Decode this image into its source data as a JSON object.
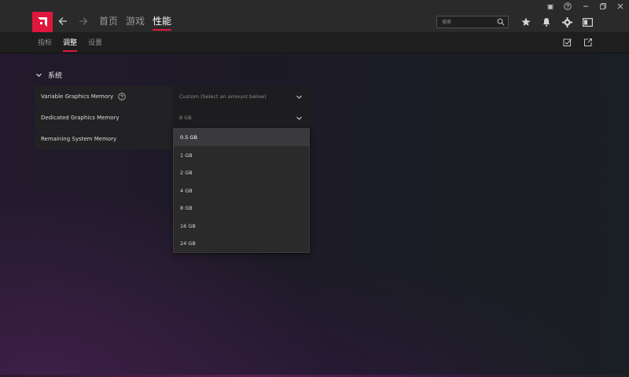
{
  "colors": {
    "accent": "#e0173d",
    "topbar": "#2a2a2b",
    "subbar": "#1e1e1f"
  },
  "topbar": {
    "logo_icon": "amd-logo-icon",
    "tabs": [
      {
        "label": "首页",
        "active": false
      },
      {
        "label": "游戏",
        "active": false
      },
      {
        "label": "性能",
        "active": true
      }
    ],
    "search": {
      "placeholder": "搜索",
      "value": "",
      "icon": "search-icon"
    },
    "tools": [
      "star-icon",
      "bell-icon",
      "gear-icon",
      "panel-icon"
    ],
    "window": [
      "bug-icon",
      "help-icon",
      "minimize-icon",
      "restore-icon",
      "close-icon"
    ]
  },
  "subtabs": [
    {
      "label": "指标",
      "active": false
    },
    {
      "label": "调整",
      "active": true
    },
    {
      "label": "设置",
      "active": false
    }
  ],
  "section": {
    "title": "系统",
    "rows": [
      {
        "label": "Variable Graphics Memory",
        "value": "Custom (Select an amount below)",
        "has_help": true,
        "has_dropdown": true
      },
      {
        "label": "Dedicated Graphics Memory",
        "value": "8 GB",
        "has_help": false,
        "has_dropdown": true
      },
      {
        "label": "Remaining System Memory",
        "value": "",
        "has_help": false,
        "has_dropdown": false
      }
    ]
  },
  "dropdown": {
    "options": [
      "0.5 GB",
      "1 GB",
      "2 GB",
      "4 GB",
      "8 GB",
      "16 GB",
      "24 GB"
    ],
    "highlighted": "0.5 GB"
  }
}
